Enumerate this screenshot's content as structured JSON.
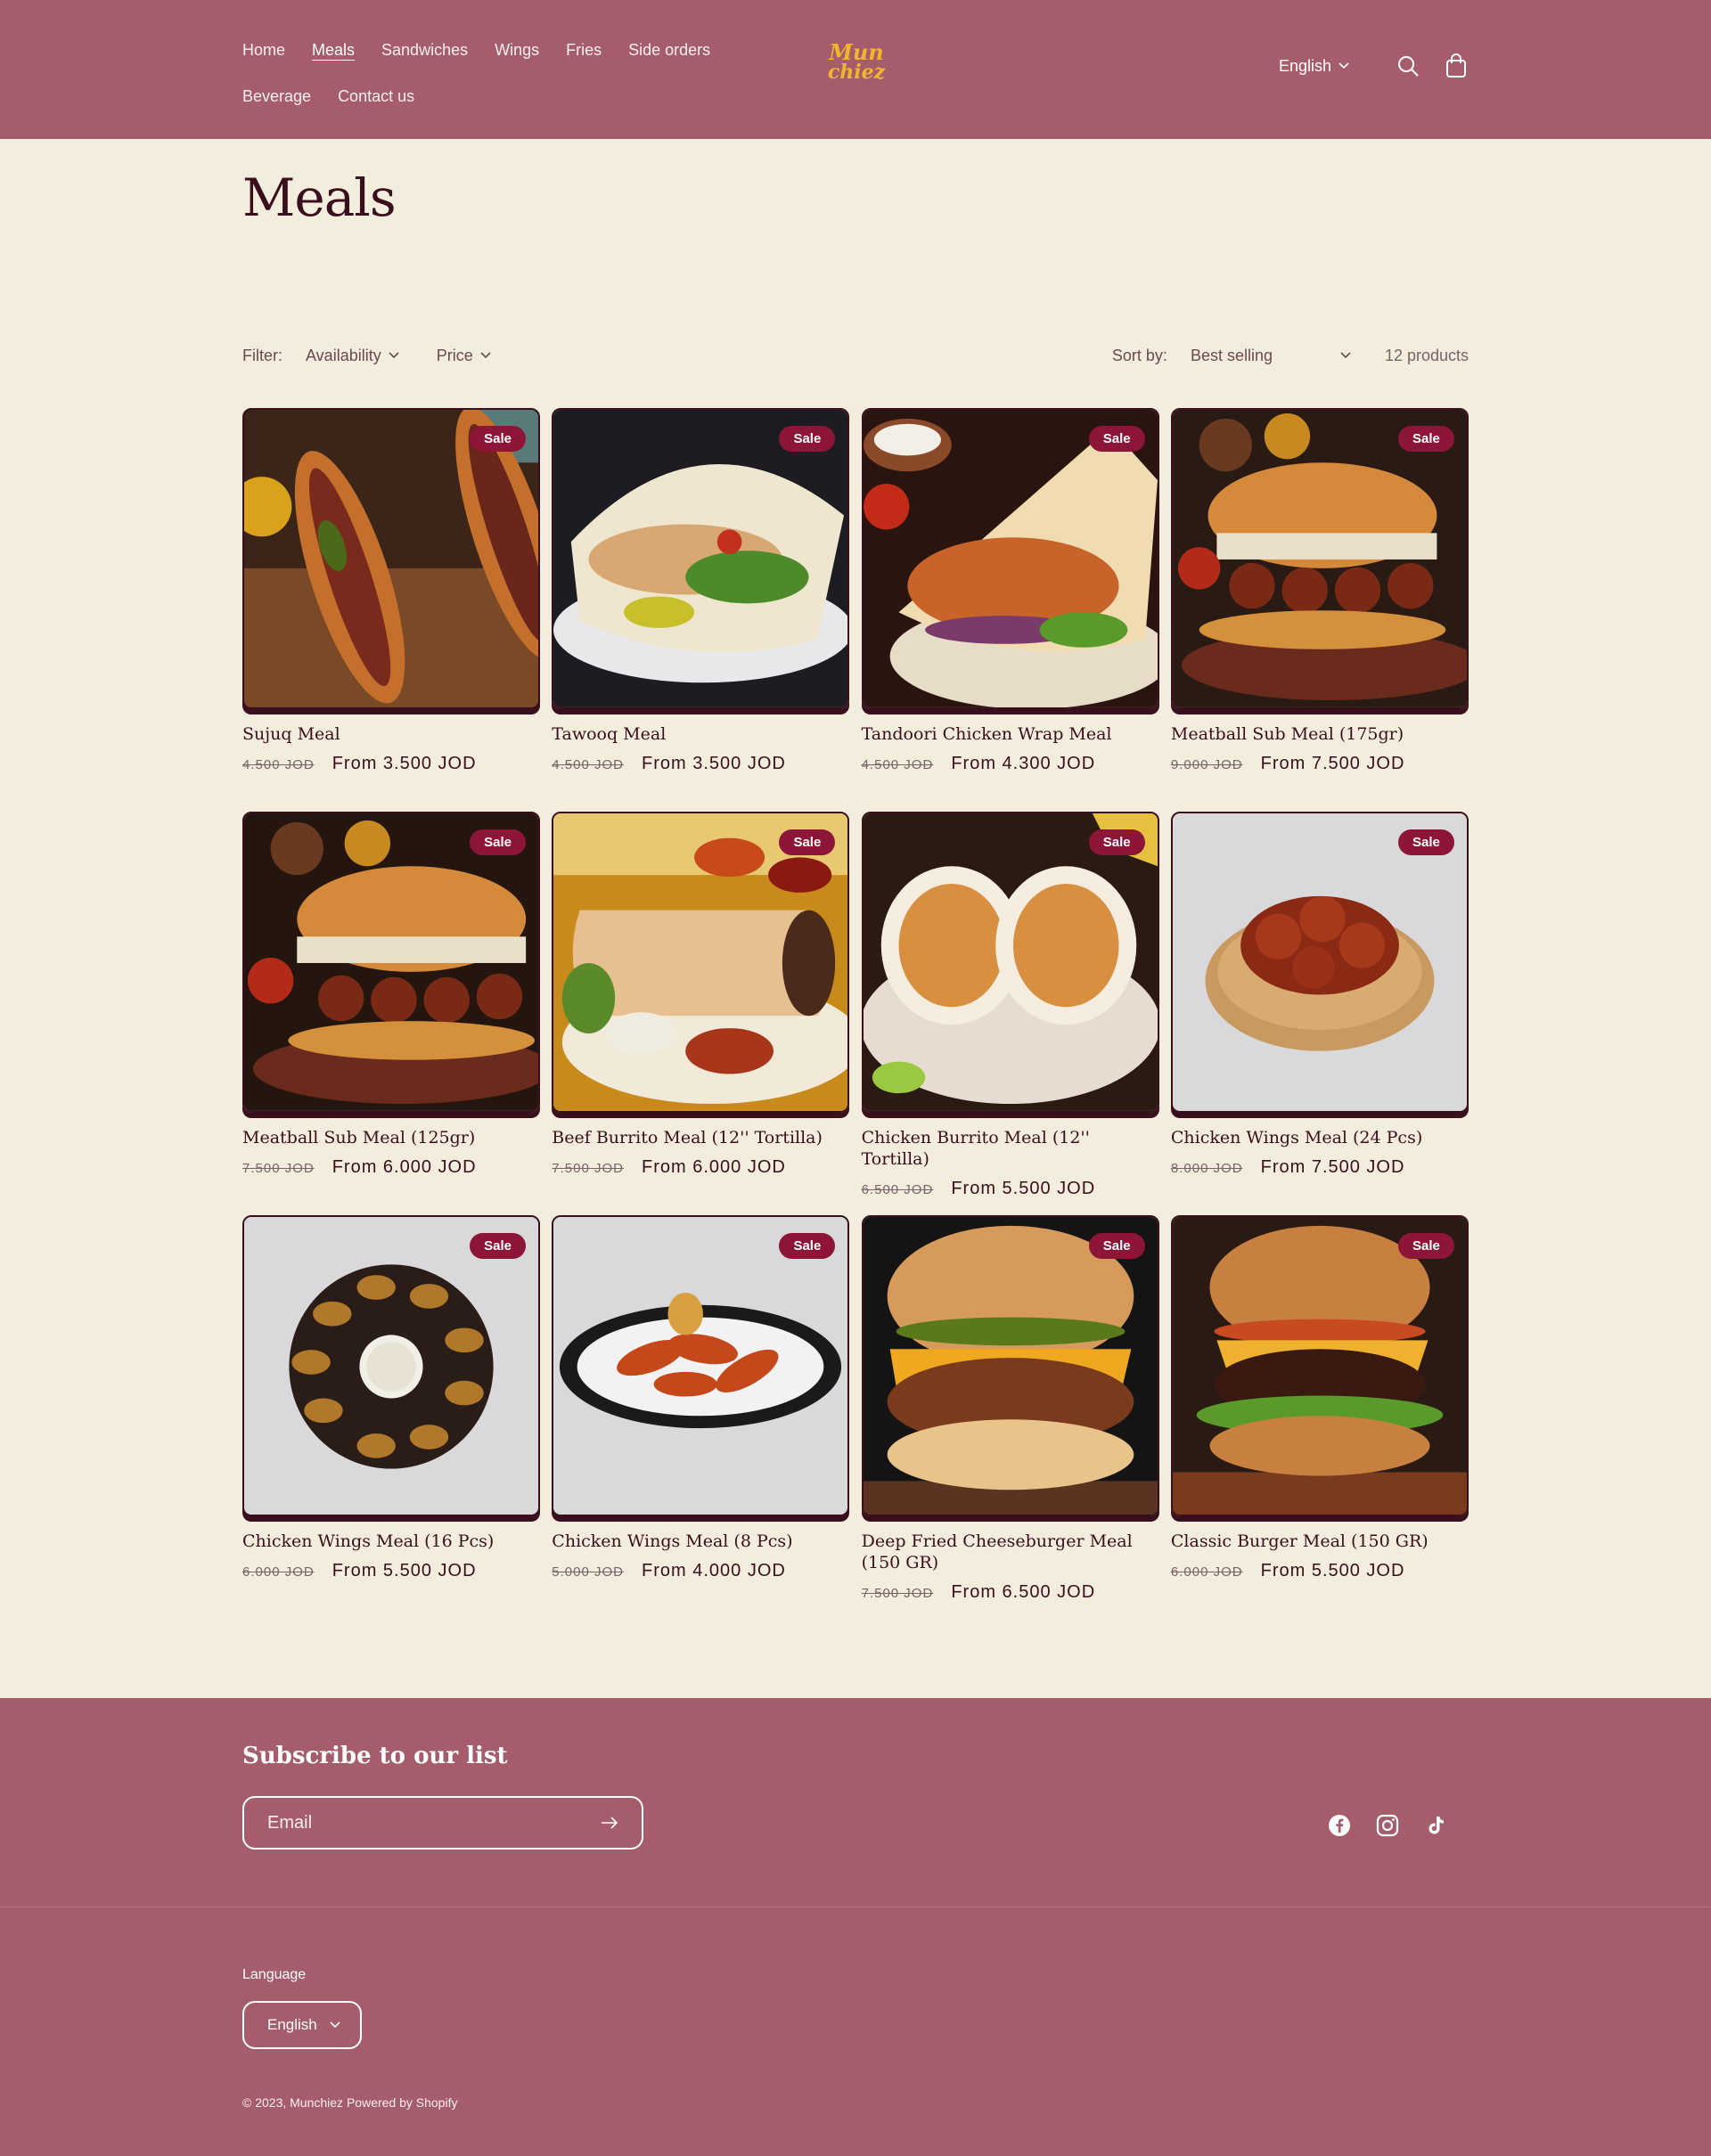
{
  "header": {
    "nav": [
      "Home",
      "Meals",
      "Sandwiches",
      "Wings",
      "Fries",
      "Side orders",
      "Beverage",
      "Contact us"
    ],
    "active_nav": "Meals",
    "logo_line1": "Mun",
    "logo_line2": "chiez",
    "language": "English",
    "icons": [
      "search-icon",
      "cart-icon"
    ]
  },
  "main": {
    "title": "Meals",
    "filter_label": "Filter:",
    "filters": [
      "Availability",
      "Price"
    ],
    "sort_label": "Sort by:",
    "sort_value": "Best selling",
    "product_count": "12 products"
  },
  "products": [
    {
      "title": "Sujuq Meal",
      "old_price": "4.500 JOD",
      "new_price": "From 3.500 JOD",
      "badge": "Sale"
    },
    {
      "title": "Tawooq Meal",
      "old_price": "4.500 JOD",
      "new_price": "From 3.500 JOD",
      "badge": "Sale"
    },
    {
      "title": "Tandoori Chicken Wrap Meal",
      "old_price": "4.500 JOD",
      "new_price": "From 4.300 JOD",
      "badge": "Sale"
    },
    {
      "title": "Meatball Sub Meal (175gr)",
      "old_price": "9.000 JOD",
      "new_price": "From 7.500 JOD",
      "badge": "Sale"
    },
    {
      "title": "Meatball Sub Meal (125gr)",
      "old_price": "7.500 JOD",
      "new_price": "From 6.000 JOD",
      "badge": "Sale"
    },
    {
      "title": "Beef Burrito Meal (12'' Tortilla)",
      "old_price": "7.500 JOD",
      "new_price": "From 6.000 JOD",
      "badge": "Sale"
    },
    {
      "title": "Chicken Burrito Meal (12'' Tortilla)",
      "old_price": "6.500 JOD",
      "new_price": "From 5.500 JOD",
      "badge": "Sale"
    },
    {
      "title": "Chicken Wings Meal (24 Pcs)",
      "old_price": "8.000 JOD",
      "new_price": "From 7.500 JOD",
      "badge": "Sale"
    },
    {
      "title": "Chicken Wings Meal (16 Pcs)",
      "old_price": "6.000 JOD",
      "new_price": "From 5.500 JOD",
      "badge": "Sale"
    },
    {
      "title": "Chicken Wings Meal (8 Pcs)",
      "old_price": "5.000 JOD",
      "new_price": "From 4.000 JOD",
      "badge": "Sale"
    },
    {
      "title": "Deep Fried Cheeseburger Meal (150 GR)",
      "old_price": "7.500 JOD",
      "new_price": "From 6.500 JOD",
      "badge": "Sale"
    },
    {
      "title": "Classic Burger Meal (150 GR)",
      "old_price": "6.000 JOD",
      "new_price": "From 5.500 JOD",
      "badge": "Sale"
    }
  ],
  "footer": {
    "subscribe_title": "Subscribe to our list",
    "email_placeholder": "Email",
    "social": [
      "facebook-icon",
      "instagram-icon",
      "tiktok-icon"
    ],
    "language_label": "Language",
    "language_value": "English",
    "copyright_prefix": "© 2023,",
    "copyright_brand": "Munchiez",
    "copyright_powered": "Powered by Shopify"
  },
  "colors": {
    "header_bg": "#a55d6b",
    "page_bg": "#f2eddc",
    "badge": "#8c1538",
    "text_dark": "#3a0f1d",
    "logo": "#f3b52f"
  }
}
